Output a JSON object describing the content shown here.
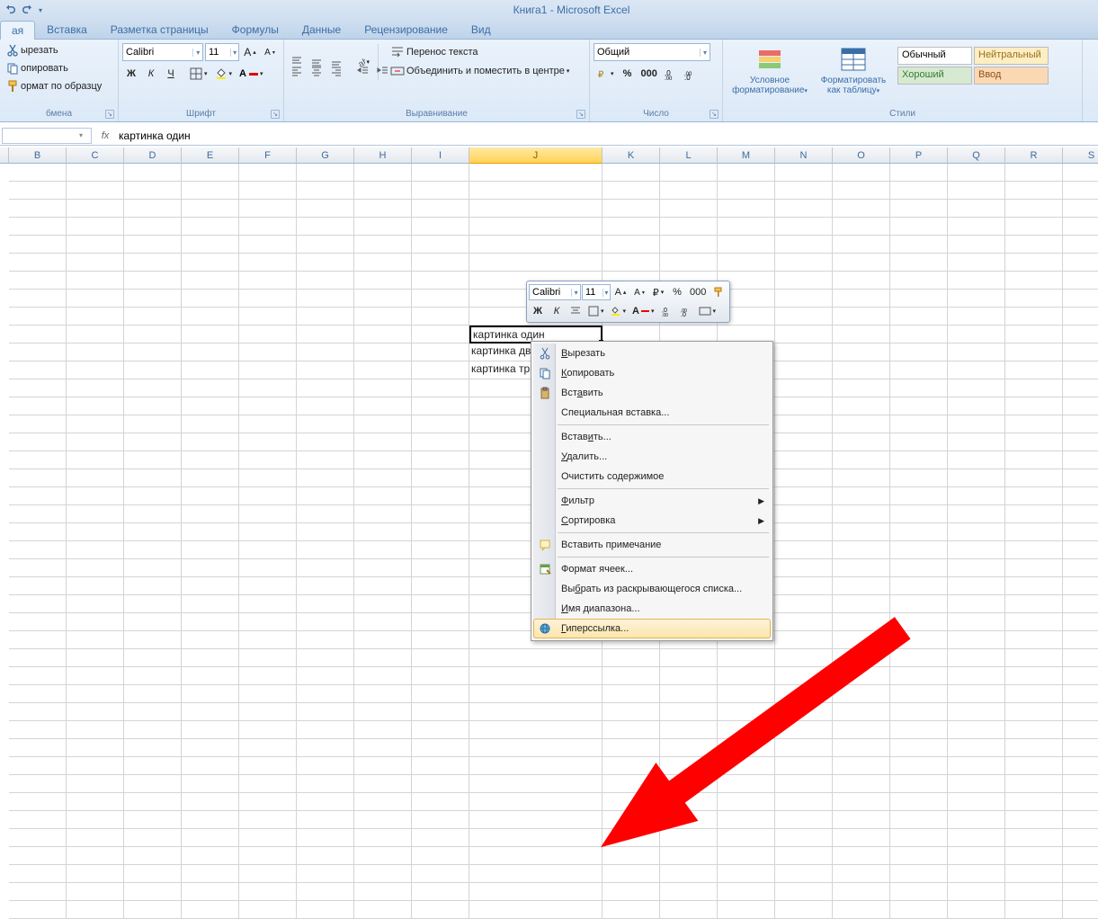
{
  "app": {
    "title": "Книга1 - Microsoft Excel"
  },
  "tabs": [
    "ая",
    "Вставка",
    "Разметка страницы",
    "Формулы",
    "Данные",
    "Рецензирование",
    "Вид"
  ],
  "clipboard": {
    "cut": "ырезать",
    "copy": "опировать",
    "format": "ормат по образцу",
    "label": "бмена"
  },
  "font": {
    "name": "Calibri",
    "size": "11",
    "label": "Шрифт",
    "bold": "Ж",
    "italic": "К",
    "underline": "Ч"
  },
  "align": {
    "label": "Выравнивание",
    "wrap": "Перенос текста",
    "merge": "Объединить и поместить в центре"
  },
  "number": {
    "label": "Число",
    "format": "Общий"
  },
  "styles": {
    "label": "Стили",
    "cond": "Условное",
    "cond2": "форматирование",
    "fmttbl": "Форматировать",
    "fmttbl2": "как таблицу",
    "cells": [
      {
        "text": "Обычный",
        "bg": "#ffffff",
        "color": "#000",
        "border": "#bfbfbf"
      },
      {
        "text": "Нейтральный",
        "bg": "#fdeec3",
        "color": "#9a6f1d"
      },
      {
        "text": "Хороший",
        "bg": "#d6ead2",
        "color": "#367b2e"
      },
      {
        "text": "Ввод",
        "bg": "#fbd8b4",
        "color": "#8e5316"
      }
    ]
  },
  "fbar": {
    "cell": "",
    "fx": "fx",
    "formula": "картинка один"
  },
  "columns": [
    "B",
    "C",
    "D",
    "E",
    "F",
    "G",
    "H",
    "I",
    "J",
    "K",
    "L",
    "M",
    "N",
    "O",
    "P",
    "Q",
    "R",
    "S"
  ],
  "selcol": "J",
  "cells": [
    {
      "r": 0,
      "c": 8,
      "text": "картинка один",
      "selected": true
    },
    {
      "r": 1,
      "c": 8,
      "text": "картинка два"
    },
    {
      "r": 2,
      "c": 8,
      "text": "картинка три"
    }
  ],
  "minibar": {
    "font": "Calibri",
    "size": "11"
  },
  "ctx": [
    {
      "text": "Вырезать",
      "u": 0,
      "icon": "cut"
    },
    {
      "text": "Копировать",
      "u": 0,
      "icon": "copy"
    },
    {
      "text": "Вставить",
      "u": 3,
      "icon": "paste"
    },
    {
      "text": "Специальная вставка...",
      "u": -1
    },
    {
      "sep": true
    },
    {
      "text": "Вставить...",
      "u": 5
    },
    {
      "text": "Удалить...",
      "u": 0
    },
    {
      "text": "Очистить содержимое",
      "u": -1
    },
    {
      "sep": true
    },
    {
      "text": "Фильтр",
      "u": 0,
      "sub": true
    },
    {
      "text": "Сортировка",
      "u": 0,
      "sub": true
    },
    {
      "sep": true
    },
    {
      "text": "Вставить примечание",
      "u": -1,
      "icon": "comment"
    },
    {
      "sep": true
    },
    {
      "text": "Формат ячеек...",
      "u": -1,
      "icon": "fmt"
    },
    {
      "text": "Выбрать из раскрывающегося списка...",
      "u": 2
    },
    {
      "text": "Имя диапазона...",
      "u": 0
    },
    {
      "text": "Гиперссылка...",
      "u": 0,
      "icon": "link",
      "hover": true
    }
  ]
}
